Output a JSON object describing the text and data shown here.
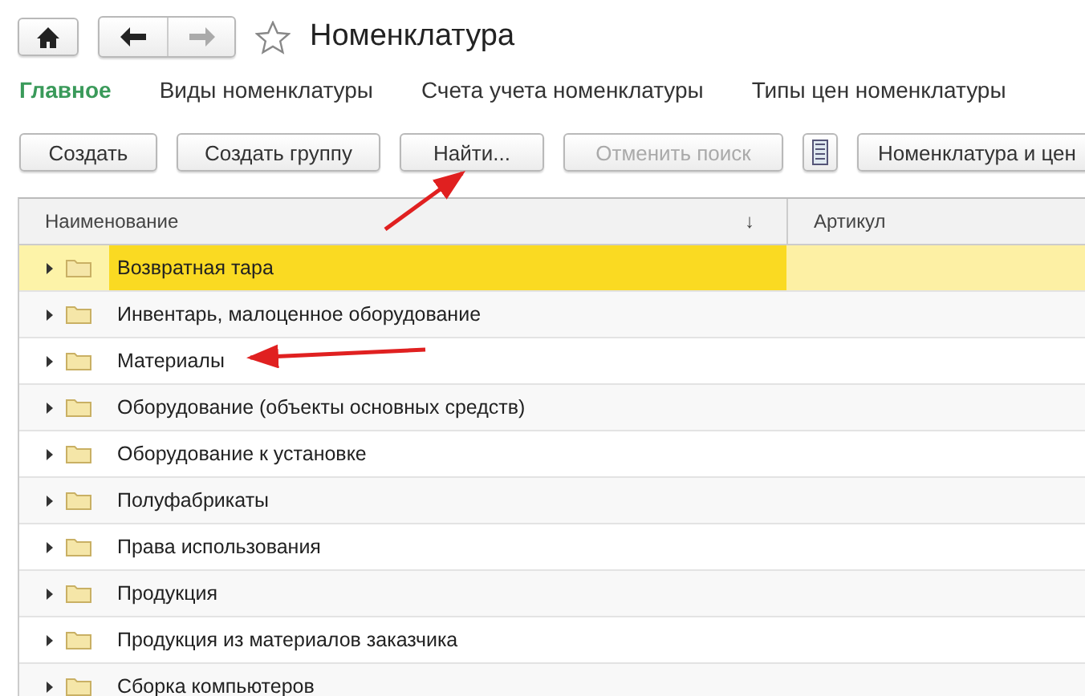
{
  "window": {
    "title": "Номенклатура"
  },
  "nav": [
    {
      "label": "Главное",
      "selected": true
    },
    {
      "label": "Виды номенклатуры",
      "selected": false
    },
    {
      "label": "Счета учета номенклатуры",
      "selected": false
    },
    {
      "label": "Типы цен номенклатуры",
      "selected": false
    }
  ],
  "toolbar": [
    {
      "kind": "button",
      "label": "Создать",
      "disabled": false
    },
    {
      "kind": "button",
      "label": "Создать группу",
      "disabled": false
    },
    {
      "kind": "button",
      "label": "Найти...",
      "disabled": false
    },
    {
      "kind": "button",
      "label": "Отменить поиск",
      "disabled": true
    },
    {
      "kind": "icon"
    },
    {
      "kind": "button",
      "label": "Номенклатура и цен",
      "disabled": false
    }
  ],
  "table": {
    "columns": [
      {
        "label": "Наименование",
        "sort": "↓"
      },
      {
        "label": "Артикул"
      }
    ],
    "rows": [
      {
        "name": "Возвратная тара",
        "selected": true
      },
      {
        "name": "Инвентарь, малоценное оборудование",
        "selected": false
      },
      {
        "name": "Материалы",
        "selected": false
      },
      {
        "name": "Оборудование (объекты основных средств)",
        "selected": false
      },
      {
        "name": "Оборудование к установке",
        "selected": false
      },
      {
        "name": "Полуфабрикаты",
        "selected": false
      },
      {
        "name": "Права использования",
        "selected": false
      },
      {
        "name": "Продукция",
        "selected": false
      },
      {
        "name": "Продукция из материалов заказчика",
        "selected": false
      },
      {
        "name": "Сборка компьютеров",
        "selected": false
      }
    ]
  }
}
